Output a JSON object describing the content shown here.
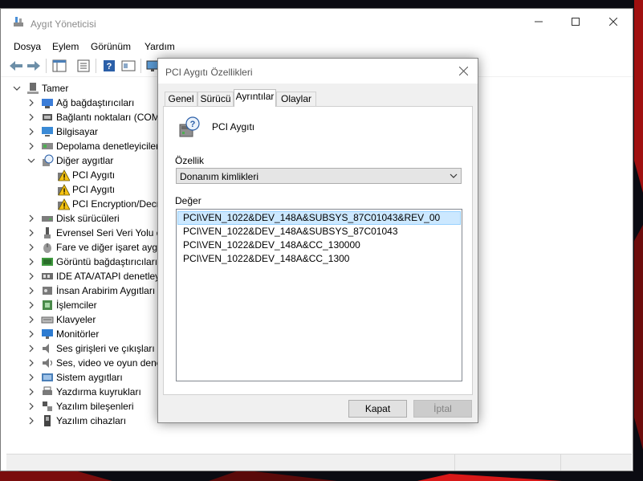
{
  "main_window": {
    "title": "Aygıt Yöneticisi",
    "menu": [
      "Dosya",
      "Eylem",
      "Görünüm",
      "Yardım"
    ]
  },
  "tree": {
    "root": "Tamer",
    "items": [
      {
        "label": "Ağ bağdaştırıcıları",
        "icon": "network-adapter-icon",
        "expanded": false
      },
      {
        "label": "Bağlantı noktaları (COM",
        "icon": "port-icon",
        "expanded": false
      },
      {
        "label": "Bilgisayar",
        "icon": "computer-icon",
        "expanded": false
      },
      {
        "label": "Depolama denetleyiciler",
        "icon": "storage-controller-icon",
        "expanded": false
      },
      {
        "label": "Diğer aygıtlar",
        "icon": "other-devices-icon",
        "expanded": true
      },
      {
        "label": "PCI Aygıtı",
        "icon": "warning-device-icon",
        "child": true
      },
      {
        "label": "PCI Aygıtı",
        "icon": "warning-device-icon",
        "child": true
      },
      {
        "label": "PCI Encryption/Decr",
        "icon": "warning-device-icon",
        "child": true
      },
      {
        "label": "Disk sürücüleri",
        "icon": "disk-drive-icon",
        "expanded": false
      },
      {
        "label": "Evrensel Seri Veri Yolu de",
        "icon": "usb-icon",
        "expanded": false
      },
      {
        "label": "Fare ve diğer işaret aygıt",
        "icon": "mouse-icon",
        "expanded": false
      },
      {
        "label": "Görüntü bağdaştırıcıları",
        "icon": "display-adapter-icon",
        "expanded": false
      },
      {
        "label": "IDE ATA/ATAPI denetleyi",
        "icon": "ide-controller-icon",
        "expanded": false
      },
      {
        "label": "İnsan Arabirim Aygıtları",
        "icon": "hid-icon",
        "expanded": false
      },
      {
        "label": "İşlemciler",
        "icon": "processor-icon",
        "expanded": false
      },
      {
        "label": "Klavyeler",
        "icon": "keyboard-icon",
        "expanded": false
      },
      {
        "label": "Monitörler",
        "icon": "monitor-icon",
        "expanded": false
      },
      {
        "label": "Ses girişleri ve çıkışları",
        "icon": "audio-io-icon",
        "expanded": false
      },
      {
        "label": "Ses, video ve oyun dene",
        "icon": "sound-video-icon",
        "expanded": false
      },
      {
        "label": "Sistem aygıtları",
        "icon": "system-devices-icon",
        "expanded": false
      },
      {
        "label": "Yazdırma kuyrukları",
        "icon": "printer-icon",
        "expanded": false
      },
      {
        "label": "Yazılım bileşenleri",
        "icon": "software-component-icon",
        "expanded": false
      },
      {
        "label": "Yazılım cihazları",
        "icon": "software-device-icon",
        "expanded": false
      }
    ]
  },
  "dialog": {
    "title": "PCI Aygıtı Özellikleri",
    "tabs": [
      "Genel",
      "Sürücü",
      "Ayrıntılar",
      "Olaylar"
    ],
    "active_tab": "Ayrıntılar",
    "device_name": "PCI Aygıtı",
    "property_label": "Özellik",
    "property_value": "Donanım kimlikleri",
    "value_label": "Değer",
    "values": [
      "PCI\\VEN_1022&DEV_148A&SUBSYS_87C01043&REV_00",
      "PCI\\VEN_1022&DEV_148A&SUBSYS_87C01043",
      "PCI\\VEN_1022&DEV_148A&CC_130000",
      "PCI\\VEN_1022&DEV_148A&CC_1300"
    ],
    "ok_label": "Kapat",
    "cancel_label": "İptal"
  },
  "colors": {
    "accent_selection": "#cce8ff",
    "warning": "#f5c211",
    "desktop": "#0b0b12"
  }
}
